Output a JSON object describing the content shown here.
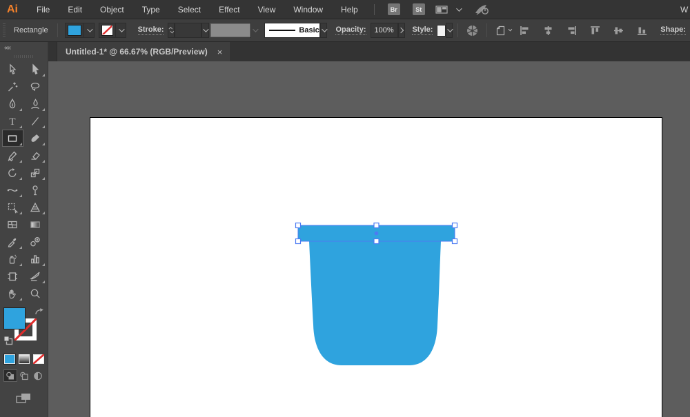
{
  "app": {
    "logo_text": "Ai",
    "badge_bridge": "Br",
    "badge_stock": "St",
    "workspace_cut": "W"
  },
  "menu": {
    "items": [
      "File",
      "Edit",
      "Object",
      "Type",
      "Select",
      "Effect",
      "View",
      "Window",
      "Help"
    ]
  },
  "control": {
    "tool_name": "Rectangle",
    "stroke_label": "Stroke:",
    "stroke_weight_value": "",
    "brush_value": "",
    "stroke_style_value": "Basic",
    "opacity_label": "Opacity:",
    "opacity_value": "100%",
    "style_label": "Style:",
    "shape_label": "Shape:"
  },
  "tab": {
    "title": "Untitled-1* @ 66.67% (RGB/Preview)",
    "close_glyph": "×"
  },
  "toolbar": {
    "collapse_glyph": "««",
    "tools": [
      "selection",
      "direct-selection",
      "magic-wand",
      "lasso",
      "pen",
      "curvature",
      "type",
      "line-segment",
      "rectangle",
      "paintbrush",
      "shaper",
      "eraser",
      "rotate",
      "scale",
      "width",
      "puppet-warp",
      "free-transform",
      "perspective-grid",
      "mesh",
      "gradient",
      "eyedropper",
      "blend",
      "symbol-sprayer",
      "column-graph",
      "artboard",
      "slice",
      "hand",
      "zoom"
    ],
    "active_tool": "rectangle"
  },
  "colors": {
    "shape_fill_blue": "#2FA3DE",
    "selection_blue": "#4D7BF3",
    "none_indicator_red": "#E02B2B",
    "logo_orange": "#F5822B",
    "artboard_white": "#FFFFFF"
  },
  "canvas_state": {
    "document_zoom": "66.67%",
    "color_mode": "RGB/Preview",
    "selection": "top bar rectangle of bucket shape selected with 6 handles"
  }
}
